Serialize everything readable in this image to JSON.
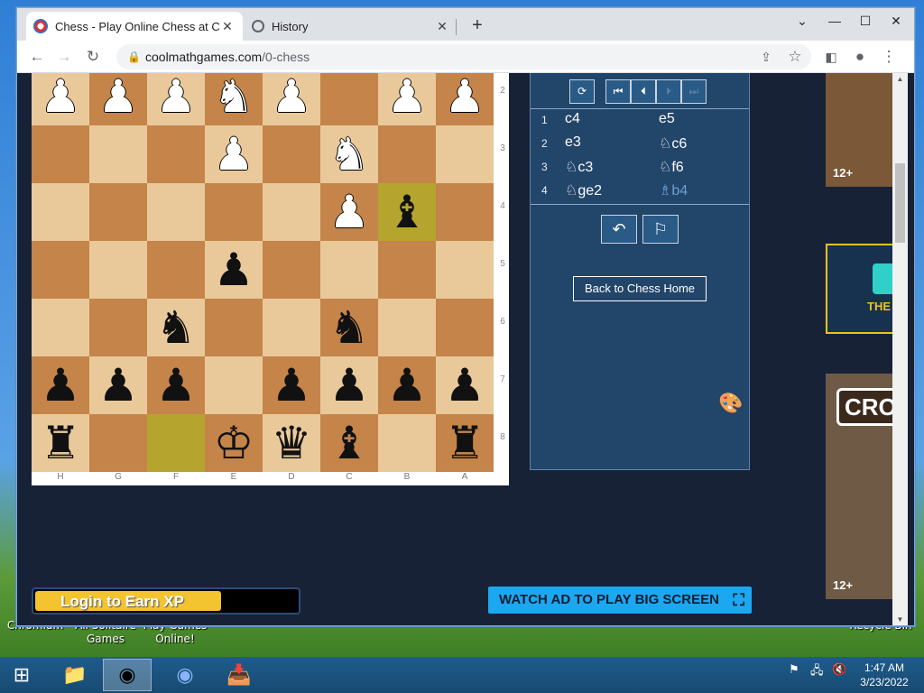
{
  "desktop": {
    "icons": [
      "Chromium",
      "All Solitaire Games",
      "Play Games Online!",
      "Recycle Bin"
    ]
  },
  "browser": {
    "tabs": [
      {
        "title": "Chess - Play Online Chess at Coo",
        "active": true
      },
      {
        "title": "History",
        "active": false
      }
    ],
    "url_host": "coolmathgames.com",
    "url_path": "/0-chess",
    "controls": {
      "minimize": "—",
      "maximize": "☐",
      "close": "✕"
    }
  },
  "board": {
    "ranks": [
      "2",
      "3",
      "4",
      "5",
      "6",
      "7",
      "8"
    ],
    "files": [
      "H",
      "G",
      "F",
      "E",
      "D",
      "C",
      "B",
      "A"
    ],
    "rows": [
      [
        {
          "p": "♟",
          "c": "w"
        },
        {
          "p": "♟",
          "c": "w"
        },
        {
          "p": "♟",
          "c": "w"
        },
        {
          "p": "♞",
          "c": "w"
        },
        {
          "p": "♟",
          "c": "w"
        },
        {
          "p": "",
          "c": ""
        },
        {
          "p": "♟",
          "c": "w"
        },
        {
          "p": "♟",
          "c": "w"
        }
      ],
      [
        {
          "p": "",
          "c": ""
        },
        {
          "p": "",
          "c": ""
        },
        {
          "p": "",
          "c": ""
        },
        {
          "p": "♟",
          "c": "w"
        },
        {
          "p": "",
          "c": ""
        },
        {
          "p": "♞",
          "c": "w"
        },
        {
          "p": "",
          "c": ""
        },
        {
          "p": "",
          "c": ""
        }
      ],
      [
        {
          "p": "",
          "c": ""
        },
        {
          "p": "",
          "c": ""
        },
        {
          "p": "",
          "c": ""
        },
        {
          "p": "",
          "c": ""
        },
        {
          "p": "",
          "c": ""
        },
        {
          "p": "♟",
          "c": "w"
        },
        {
          "p": "♝",
          "c": "b",
          "hl": true
        },
        {
          "p": "",
          "c": ""
        }
      ],
      [
        {
          "p": "",
          "c": ""
        },
        {
          "p": "",
          "c": ""
        },
        {
          "p": "",
          "c": ""
        },
        {
          "p": "♟",
          "c": "b"
        },
        {
          "p": "",
          "c": ""
        },
        {
          "p": "",
          "c": ""
        },
        {
          "p": "",
          "c": ""
        },
        {
          "p": "",
          "c": ""
        }
      ],
      [
        {
          "p": "",
          "c": ""
        },
        {
          "p": "",
          "c": ""
        },
        {
          "p": "♞",
          "c": "b"
        },
        {
          "p": "",
          "c": ""
        },
        {
          "p": "",
          "c": ""
        },
        {
          "p": "♞",
          "c": "b"
        },
        {
          "p": "",
          "c": ""
        },
        {
          "p": "",
          "c": ""
        }
      ],
      [
        {
          "p": "♟",
          "c": "b"
        },
        {
          "p": "♟",
          "c": "b"
        },
        {
          "p": "♟",
          "c": "b"
        },
        {
          "p": "",
          "c": ""
        },
        {
          "p": "♟",
          "c": "b"
        },
        {
          "p": "♟",
          "c": "b"
        },
        {
          "p": "♟",
          "c": "b"
        },
        {
          "p": "♟",
          "c": "b"
        }
      ],
      [
        {
          "p": "♜",
          "c": "b"
        },
        {
          "p": "",
          "c": ""
        },
        {
          "p": "",
          "c": "",
          "hl": true
        },
        {
          "p": "♔",
          "c": "b"
        },
        {
          "p": "♛",
          "c": "b"
        },
        {
          "p": "♝",
          "c": "b"
        },
        {
          "p": "",
          "c": ""
        },
        {
          "p": "♜",
          "c": "b"
        }
      ]
    ]
  },
  "moves_panel": {
    "nav_icons": [
      "flip-board-icon",
      "first-move-icon",
      "prev-move-icon",
      "next-move-icon",
      "last-move-icon"
    ],
    "moves": [
      {
        "n": "1",
        "w": "c4",
        "b": "e5"
      },
      {
        "n": "2",
        "w": "e3",
        "b": "♘c6"
      },
      {
        "n": "3",
        "w": "♘c3",
        "b": "♘f6"
      },
      {
        "n": "4",
        "w": "♘ge2",
        "b": "♗b4"
      }
    ],
    "back_home": "Back to Chess Home"
  },
  "ads": {
    "rating": "12+",
    "ad2_text": "THE",
    "ad3_text": "CRO"
  },
  "footer": {
    "xp_label": "Login to Earn XP",
    "xp_progress_percent": 70,
    "watch_ad": "WATCH AD TO PLAY BIG SCREEN"
  },
  "taskbar": {
    "time": "1:47 AM",
    "date": "3/23/2022"
  },
  "colors": {
    "light_square": "#e9c99a",
    "dark_square": "#c4844a",
    "highlight": "#b5a52e",
    "panel": "#22456a",
    "page_bg": "#172236",
    "watch_btn": "#1ca8f0",
    "xp_fill": "#f4c430"
  }
}
